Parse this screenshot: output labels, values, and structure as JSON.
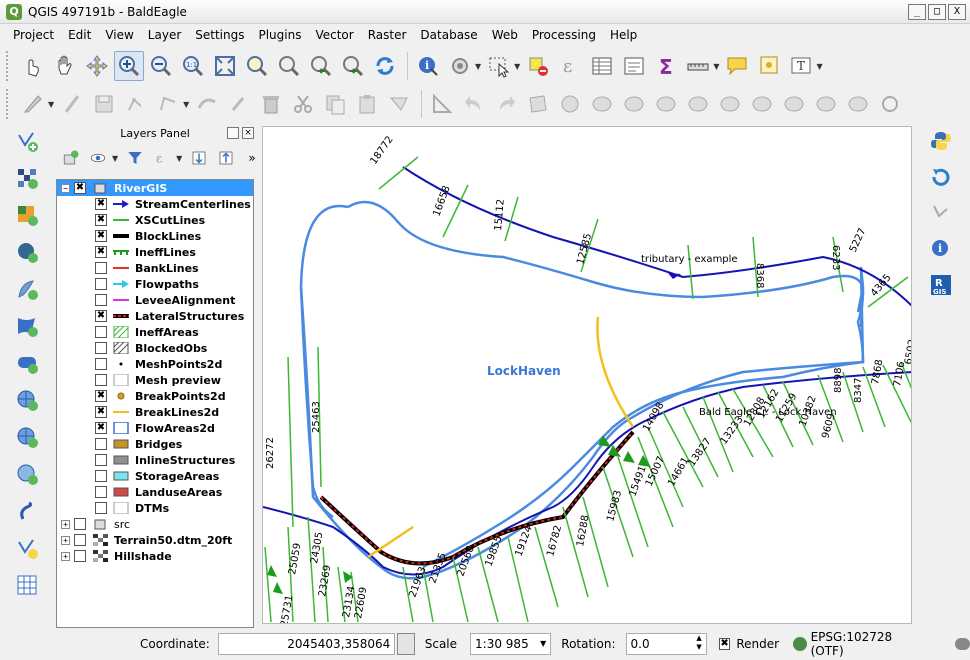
{
  "window": {
    "title": "QGIS 497191b - BaldEagle",
    "buttons": [
      "_",
      "□",
      "X"
    ]
  },
  "menu": [
    "Project",
    "Edit",
    "View",
    "Layer",
    "Settings",
    "Plugins",
    "Vector",
    "Raster",
    "Database",
    "Web",
    "Processing",
    "Help"
  ],
  "panel": {
    "title": "Layers Panel",
    "layers": [
      {
        "label": "RiverGIS",
        "checked": true,
        "group": true,
        "expanded": true,
        "selected": true
      },
      {
        "label": "StreamCenterlines",
        "checked": true,
        "sym": "arrow-line",
        "color": "#1f1fc8"
      },
      {
        "label": "XSCutLines",
        "checked": true,
        "sym": "line",
        "color": "#3cb832"
      },
      {
        "label": "BlockLines",
        "checked": true,
        "sym": "thick-line",
        "color": "#000000"
      },
      {
        "label": "IneffLines",
        "checked": true,
        "sym": "tick-line",
        "color": "#1e9a1e"
      },
      {
        "label": "BankLines",
        "checked": false,
        "sym": "line",
        "color": "#e03030"
      },
      {
        "label": "Flowpaths",
        "checked": false,
        "sym": "arrow-line",
        "color": "#30c8e8"
      },
      {
        "label": "LeveeAlignment",
        "checked": false,
        "sym": "line",
        "color": "#e030e0"
      },
      {
        "label": "LateralStructures",
        "checked": true,
        "sym": "dash-line",
        "color": "#e02020"
      },
      {
        "label": "IneffAreas",
        "checked": false,
        "sym": "hatch",
        "color": "#3cb832"
      },
      {
        "label": "BlockedObs",
        "checked": false,
        "sym": "hatch",
        "color": "#555555"
      },
      {
        "label": "MeshPoints2d",
        "checked": false,
        "sym": "dot",
        "color": "#000000"
      },
      {
        "label": "Mesh preview",
        "checked": false,
        "sym": "box",
        "color": "#ffffff"
      },
      {
        "label": "BreakPoints2d",
        "checked": true,
        "sym": "circle",
        "color": "#d8a020"
      },
      {
        "label": "BreakLines2d",
        "checked": true,
        "sym": "line",
        "color": "#f0c020"
      },
      {
        "label": "FlowAreas2d",
        "checked": true,
        "sym": "box",
        "color": "#3a6fd8"
      },
      {
        "label": "Bridges",
        "checked": false,
        "sym": "fill",
        "color": "#c8922a"
      },
      {
        "label": "InlineStructures",
        "checked": false,
        "sym": "fill",
        "color": "#909090"
      },
      {
        "label": "StorageAreas",
        "checked": false,
        "sym": "fill",
        "color": "#78e6f0"
      },
      {
        "label": "LanduseAreas",
        "checked": false,
        "sym": "fill",
        "color": "#d04848"
      },
      {
        "label": "DTMs",
        "checked": false,
        "sym": "box",
        "color": "#ffffff"
      },
      {
        "label": "src",
        "checked": false,
        "group": true,
        "expanded": false
      },
      {
        "label": "Terrain50.dtm_20ft",
        "checked": false,
        "raster": true
      },
      {
        "label": "Hillshade",
        "checked": false,
        "raster": true
      }
    ]
  },
  "map": {
    "flow_area_label": "LockHaven",
    "tributary_label": "tributary - example",
    "river_label": "Bald Eagle Cr. - Lock Haven",
    "trib_xs_labels": [
      "18772",
      "16658",
      "15112",
      "12585",
      "8368",
      "6233",
      "5227",
      "4365"
    ],
    "main_xs_labels": [
      "25463",
      "26272",
      "25059",
      "24305",
      "23269",
      "25731",
      "23134",
      "22609",
      "21963",
      "21355",
      "20568",
      "19855",
      "19124",
      "16782",
      "16288",
      "15983",
      "15491",
      "15007",
      "14661",
      "14098",
      "13827",
      "13233",
      "12808",
      "12162",
      "11259",
      "10382",
      "9609",
      "8898",
      "8347",
      "7868",
      "7106",
      "6502"
    ]
  },
  "status": {
    "coordinate_label": "Coordinate:",
    "coordinate": "2045403,358064",
    "scale_label": "Scale",
    "scale": "1:30 985",
    "rotation_label": "Rotation:",
    "rotation": "0.0",
    "render_label": "Render",
    "render_checked": true,
    "crs": "EPSG:102728 (OTF)"
  }
}
